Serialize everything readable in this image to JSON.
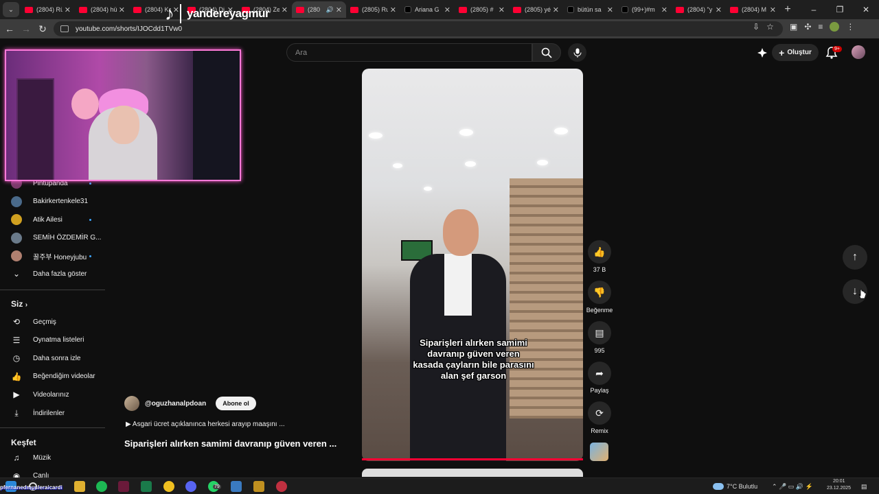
{
  "browser": {
    "tabs": [
      {
        "label": "(2804) Rü",
        "icon": "youtube-icon"
      },
      {
        "label": "(2804) hü",
        "icon": "youtube-icon"
      },
      {
        "label": "(2804) Ka",
        "icon": "youtube-icon"
      },
      {
        "label": "(2804) Di",
        "icon": "youtube-icon"
      },
      {
        "label": "(2804) Ze",
        "icon": "youtube-icon"
      },
      {
        "label": "(280",
        "icon": "youtube-icon",
        "active": true
      },
      {
        "label": "(2805) Ru",
        "icon": "youtube-icon"
      },
      {
        "label": "Ariana G",
        "icon": "tiktok-icon"
      },
      {
        "label": "(2805) #",
        "icon": "youtube-icon"
      },
      {
        "label": "(2805) yé",
        "icon": "youtube-icon"
      },
      {
        "label": "bütün sa",
        "icon": "tiktok-icon"
      },
      {
        "label": "(99+)#m",
        "icon": "tiktok-icon"
      },
      {
        "label": "(2804) \"y",
        "icon": "youtube-icon"
      },
      {
        "label": "(2804) M",
        "icon": "youtube-icon"
      }
    ],
    "url": "youtube.com/shorts/IJOCdd1TVw0",
    "new_tab": "+",
    "window_controls": [
      "–",
      "❐",
      "✕"
    ]
  },
  "stream_overlay": {
    "handle": "yandereyagmur"
  },
  "sidebar": {
    "subscriptions": [
      {
        "label": "Pintupanda",
        "dot": true
      },
      {
        "label": "Bakirkertenkele31",
        "dot": false
      },
      {
        "label": "Atik Ailesi",
        "dot": true
      },
      {
        "label": "SEMİH ÖZDEMİR G...",
        "dot": false
      },
      {
        "label": "꿀주부 Honeyjubu",
        "dot": true
      }
    ],
    "show_more": "Daha fazla göster",
    "you_header": "Siz",
    "you_items": [
      {
        "label": "Geçmiş",
        "icon": "history-icon"
      },
      {
        "label": "Oynatma listeleri",
        "icon": "playlist-icon"
      },
      {
        "label": "Daha sonra izle",
        "icon": "clock-icon"
      },
      {
        "label": "Beğendiğim videolar",
        "icon": "thumbs-up-icon"
      },
      {
        "label": "Videolarınız",
        "icon": "play-box-icon"
      },
      {
        "label": "İndirilenler",
        "icon": "download-icon"
      }
    ],
    "explore_header": "Keşfet",
    "explore_items": [
      {
        "label": "Müzik",
        "icon": "music-icon"
      },
      {
        "label": "Canlı",
        "icon": "live-icon"
      }
    ]
  },
  "topbar": {
    "search_placeholder": "Ara",
    "create_label": "Oluştur",
    "notif_badge": "9+"
  },
  "video": {
    "caption_lines": [
      "Siparişleri alırken samimi",
      "davranıp güven veren",
      "kasada çayların bile parasını",
      "alan şef garson"
    ],
    "channel": "@oguzhanalpdoan",
    "subscribe": "Abone ol",
    "description": "▶ Asgari ücret açıklanınca herkesi arayıp maaşını ...",
    "title": "Siparişleri alırken samimi davranıp güven veren ..."
  },
  "actions": {
    "likes": "37 B",
    "dislike": "Beğenme",
    "comments": "995",
    "share": "Paylaş",
    "remix": "Remix"
  },
  "taskbar": {
    "weather": "7°C  Bulutlu",
    "time": "20:01",
    "date": "23.12.2025",
    "badge": "79",
    "marquee": "pfernanedmusleraicardi"
  }
}
